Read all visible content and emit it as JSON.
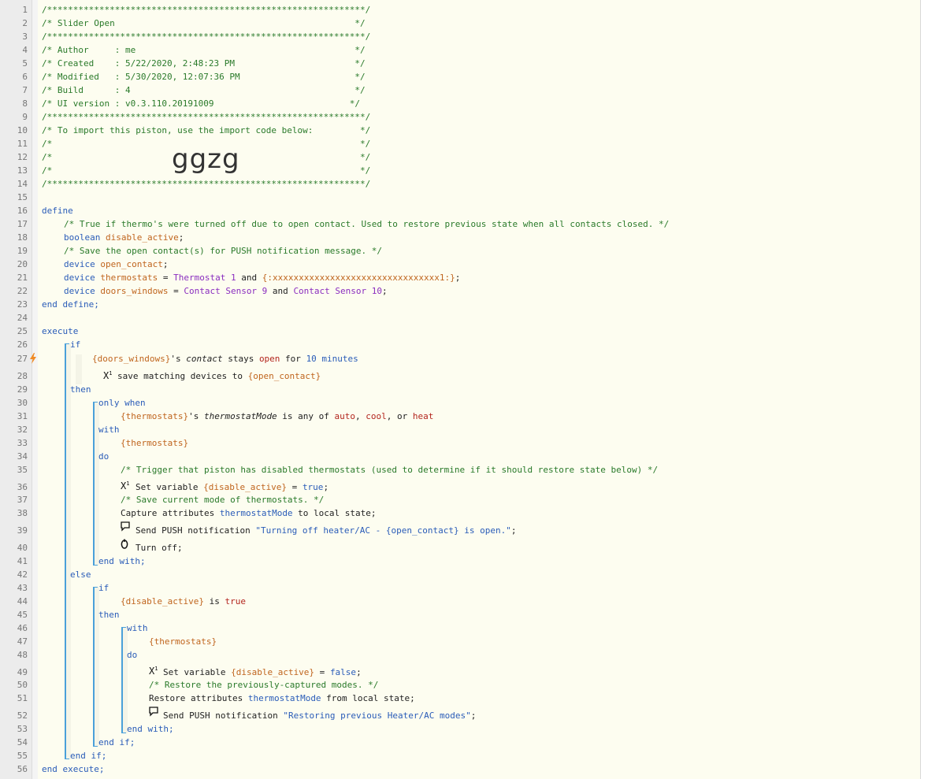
{
  "line_numbers": [
    "1",
    "2",
    "3",
    "4",
    "5",
    "6",
    "7",
    "8",
    "9",
    "10",
    "11",
    "12",
    "13",
    "14",
    "15",
    "16",
    "17",
    "18",
    "19",
    "20",
    "21",
    "22",
    "23",
    "24",
    "25",
    "26",
    "27",
    "28",
    "29",
    "30",
    "31",
    "32",
    "33",
    "34",
    "35",
    "36",
    "37",
    "38",
    "39",
    "40",
    "41",
    "42",
    "43",
    "44",
    "45",
    "46",
    "47",
    "48",
    "49",
    "50",
    "51",
    "52",
    "53",
    "54",
    "55",
    "56"
  ],
  "header": {
    "stars": "/*************************************************************/",
    "title_line": "/* Slider Open                                              */",
    "author_line": "/* Author     : me                                          */",
    "created_line": "/* Created    : 5/22/2020, 2:48:23 PM                       */",
    "modified_line": "/* Modified   : 5/30/2020, 12:07:36 PM                      */",
    "build_line": "/* Build      : 4                                           */",
    "ui_line": "/* UI version : v0.3.110.20191009                          */",
    "import_line": "/* To import this piston, use the import code below:         */",
    "blank_line": "/*                                                           */",
    "import_code": "ggzg"
  },
  "define": {
    "kw_define": "define",
    "c1": "/* True if thermo's were turned off due to open contact. Used to restore previous state when all contacts closed. */",
    "t_boolean": "boolean",
    "v_disable_active": "disable_active",
    "semi": ";",
    "c2": "/* Save the open contact(s) for PUSH notification message. */",
    "t_device": "device",
    "v_open_contact": "open_contact",
    "v_thermostats": "thermostats",
    "eq": " = ",
    "d_thermostat1": "Thermostat 1",
    "and": " and ",
    "d_obfuscated": "{:xxxxxxxxxxxxxxxxxxxxxxxxxxxxxxxx1:}",
    "v_doors_windows": "doors_windows",
    "d_contact9": "Contact Sensor 9",
    "d_contact10": "Contact Sensor 10",
    "end_define": "end define;"
  },
  "execute": {
    "kw_execute": "execute",
    "kw_if": "if",
    "r_doors_windows": "{doors_windows}",
    "s_apos": "'s ",
    "attr_contact": "contact",
    "stays": " stays ",
    "val_open": "open",
    "for": " for ",
    "num_10": "10",
    "minutes": " minutes",
    "save_matching": "save matching devices to ",
    "r_open_contact": "{open_contact}",
    "kw_then": "then",
    "kw_only_when": "only when",
    "r_thermostats": "{thermostats}",
    "attr_thermostatMode": "thermostatMode",
    "is_any_of": " is any of ",
    "val_auto": "auto",
    "comma": ", ",
    "val_cool": "cool",
    "comma_or": ", or ",
    "val_heat": "heat",
    "kw_with": "with",
    "kw_do": "do",
    "c_trigger": "/* Trigger that piston has disabled thermostats (used to determine if it should restore state below) */",
    "set_variable": "Set variable ",
    "r_disable_active": "{disable_active}",
    "val_true": "true",
    "val_false": "false",
    "c_save_mode": "/* Save current mode of thermostats. */",
    "capture": "Capture attributes ",
    "to_local": " to local state;",
    "send_push": "Send PUSH notification ",
    "str_turning_off": "\"Turning off heater/AC - {open_contact} is open.\"",
    "turn_off": "Turn off;",
    "end_with": "end with;",
    "kw_else": "else",
    "is": " is ",
    "c_restore": "/* Restore the previously-captured modes. */",
    "restore": "Restore attributes ",
    "from_local": " from local state;",
    "str_restoring": "\"Restoring previous Heater/AC modes\"",
    "end_if": "end if;",
    "end_execute": "end execute;"
  },
  "icons": {
    "x1": "X",
    "x1_sup": "1",
    "chat": "chat-bubble",
    "power": "power",
    "bolt": "lightning-bolt"
  },
  "colors": {
    "comment": "#2a7a2a",
    "keyword": "#2a5cb8",
    "variable": "#c0651e",
    "device": "#8a2dbf",
    "rail": "#4aa0da",
    "bolt": "#f08a24"
  }
}
